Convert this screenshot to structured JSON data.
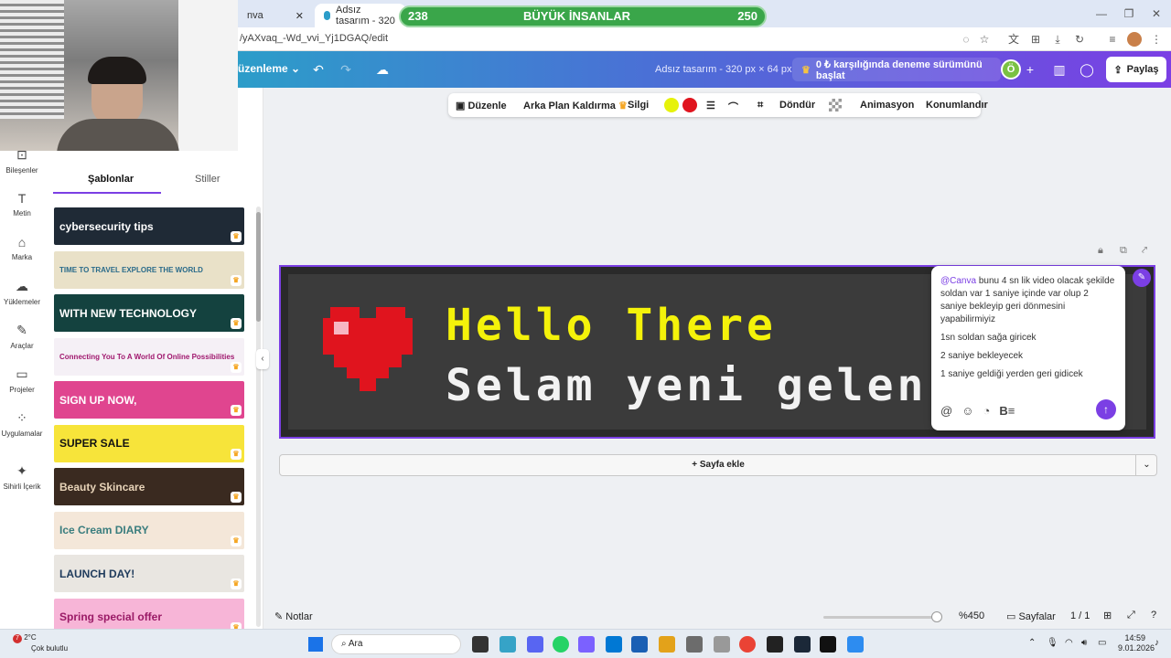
{
  "browser": {
    "tabs": [
      {
        "label": "nva"
      },
      {
        "label": "Adsız tasarım - 320"
      }
    ],
    "url": "/yAXvaq_-Wd_vvi_Yj1DGAQ/edit"
  },
  "game_banner": {
    "left_score": "238",
    "title": "BÜYÜK İNSANLAR",
    "right_score": "250"
  },
  "topbar": {
    "edit_menu": "üzenleme",
    "design_title": "Adsız tasarım - 320 px × 64 px",
    "trial_label": "0 ₺ karşılığında deneme sürümünü başlat",
    "avatar_letter": "Ö",
    "share_label": "Paylaş"
  },
  "rail": {
    "items": [
      {
        "label": "Bileşenler",
        "icon": "elements-icon"
      },
      {
        "label": "Metin",
        "icon": "text-icon"
      },
      {
        "label": "Marka",
        "icon": "brand-icon"
      },
      {
        "label": "Yüklemeler",
        "icon": "upload-icon"
      },
      {
        "label": "Araçlar",
        "icon": "tools-icon"
      },
      {
        "label": "Projeler",
        "icon": "folder-icon"
      },
      {
        "label": "Uygulamalar",
        "icon": "apps-icon"
      },
      {
        "label": "Sihirli İçerik",
        "icon": "magic-icon"
      }
    ]
  },
  "panel": {
    "tabs": [
      "Şablonlar",
      "Stiller"
    ],
    "templates": [
      {
        "label": "cybersecurity tips",
        "bg": "#1f2a36",
        "fg": "#ffffff"
      },
      {
        "label": "TIME TO TRAVEL EXPLORE THE WORLD",
        "bg": "#e9e1c8",
        "fg": "#2a6b8a"
      },
      {
        "label": "WITH NEW TECHNOLOGY",
        "bg": "#14423f",
        "fg": "#ffffff"
      },
      {
        "label": "Connecting You To A World Of Online Possibilities",
        "bg": "#f5f0f6",
        "fg": "#a0186e"
      },
      {
        "label": "SIGN UP NOW,",
        "bg": "#e0458f",
        "fg": "#ffffff"
      },
      {
        "label": "SUPER SALE",
        "bg": "#f7e43a",
        "fg": "#111111"
      },
      {
        "label": "Beauty Skincare",
        "bg": "#3a2a20",
        "fg": "#e7d3b8"
      },
      {
        "label": "Ice Cream DIARY",
        "bg": "#f4e7d9",
        "fg": "#3a7d7e"
      },
      {
        "label": "LAUNCH DAY!",
        "bg": "#e9e6e1",
        "fg": "#1f3b5c"
      },
      {
        "label": "Spring special offer",
        "bg": "#f7b5d7",
        "fg": "#9a1a66"
      }
    ]
  },
  "context_toolbar": {
    "edit": "Düzenle",
    "bg_remove": "Arka Plan Kaldırma",
    "eraser": "Silgi",
    "rotate": "Döndür",
    "animate": "Animasyon",
    "position": "Konumlandır",
    "colors": [
      "#e6f20a",
      "#e0141e"
    ]
  },
  "design": {
    "line1": "Hello There",
    "line2": "Selam yeni gelen",
    "line1_color": "#f4f20a",
    "line2_color": "#f2f2f2"
  },
  "comment": {
    "mention": "@Canva",
    "text": "bunu 4 sn lik video olacak şekilde soldan var 1 saniye içinde var olup 2 saniye bekleyip geri dönmesini yapabilirmiyiz",
    "line2": "1sn soldan sağa giricek",
    "line3": "2 saniye bekleyecek",
    "line4": "1 saniye geldiği yerden geri gidicek"
  },
  "add_page": "+ Sayfa ekle",
  "bottom": {
    "notes": "Notlar",
    "zoom": "%450",
    "pages": "Sayfalar",
    "page_count": "1 / 1"
  },
  "taskbar": {
    "weather_temp": "2°C",
    "weather_desc": "Çok bulutlu",
    "badge": "7",
    "search": "Ara",
    "time": "14:59",
    "date": "9.01.2026"
  }
}
